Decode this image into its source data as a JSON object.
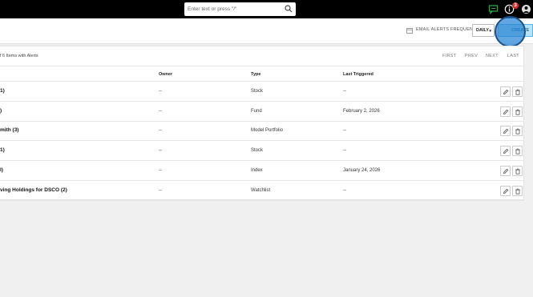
{
  "topbar": {
    "search_placeholder": "Enter text or press \"/\"",
    "notification_count": "3",
    "icons": [
      "chat-icon",
      "info-icon",
      "user-icon",
      "search-icon"
    ],
    "colors": {
      "chat": "#2ea043",
      "badge": "#d9302c"
    }
  },
  "header": {
    "email_label": "EMAIL ALERTS FREQUENCY:",
    "frequency": "DAILY",
    "create_label": "CREATE"
  },
  "list": {
    "summary": "f 6 Items with Alerts",
    "pager": {
      "first": "FIRST",
      "prev": "PREV",
      "next": "NEXT",
      "last": "LAST"
    },
    "columns": {
      "owner": "Owner",
      "type": "Type",
      "last": "Last Triggered"
    },
    "rows": [
      {
        "name": "1)",
        "owner": "--",
        "type": "Stock",
        "last": "--"
      },
      {
        "name": ")",
        "owner": "--",
        "type": "Fund",
        "last": "February 2, 2026"
      },
      {
        "name": "mith (3)",
        "owner": "--",
        "type": "Model Portfolio",
        "last": "--"
      },
      {
        "name": "1)",
        "owner": "--",
        "type": "Stock",
        "last": "--"
      },
      {
        "name": "l)",
        "owner": "--",
        "type": "Index",
        "last": "January 24, 2026"
      },
      {
        "name": "ving Holdings for DSCO (2)",
        "owner": "--",
        "type": "Watchlist",
        "last": "--"
      }
    ]
  }
}
